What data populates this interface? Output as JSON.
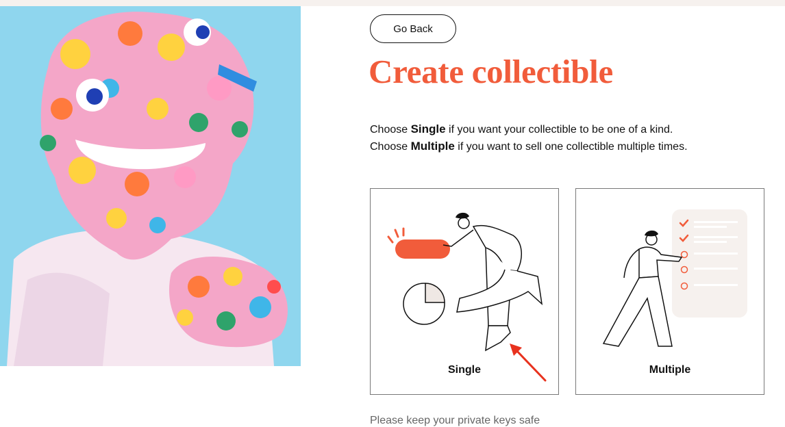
{
  "header": {
    "back_label": "Go Back"
  },
  "page": {
    "title": "Create collectible"
  },
  "description": {
    "line1": {
      "prefix": "Choose ",
      "emphasis": "Single",
      "suffix": " if you want your collectible to be one of a kind."
    },
    "line2": {
      "prefix": "Choose ",
      "emphasis": "Multiple",
      "suffix": " if you want to sell one collectible multiple times."
    }
  },
  "options": [
    {
      "label": "Single"
    },
    {
      "label": "Multiple"
    }
  ],
  "footer": {
    "note": "Please keep your private keys safe"
  },
  "colors": {
    "accent": "#f15c3b",
    "hero_bg": "#8fd6ee",
    "annotation_arrow": "#e8321e"
  }
}
